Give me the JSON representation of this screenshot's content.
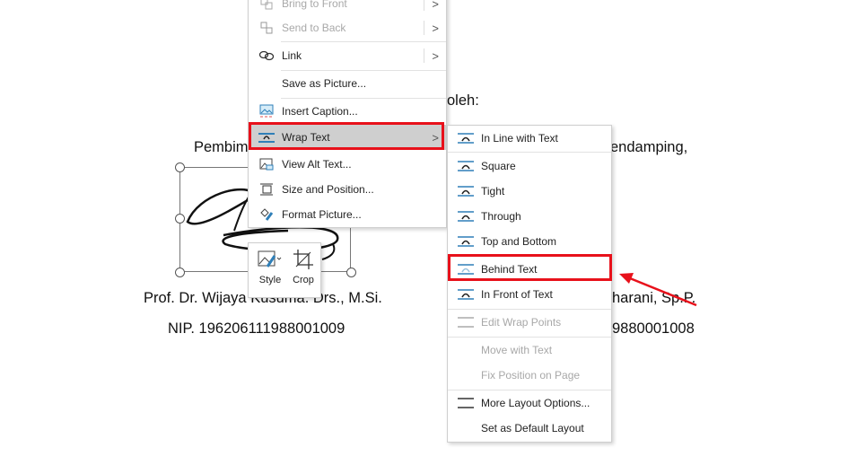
{
  "document": {
    "oleh": "oleh:",
    "left_heading": "Pembim",
    "right_heading": "endamping,",
    "left_name": "Prof. Dr. Wijaya Kusuma. Drs., M.Si.",
    "left_nip": "NIP. 196206111988001009",
    "right_name": "harani, Sp.P.",
    "right_nip": "9880001008"
  },
  "context_menu": {
    "items": [
      {
        "label": "Bring to Front",
        "icon": "bring-front-icon",
        "disabled": true,
        "submenu": true
      },
      {
        "label": "Send to Back",
        "icon": "send-back-icon",
        "disabled": true,
        "submenu": true
      },
      {
        "label": "Link",
        "icon": "link-icon",
        "submenu": true
      },
      {
        "label": "Save as Picture..."
      },
      {
        "label": "Insert Caption...",
        "icon": "caption-icon"
      },
      {
        "label": "Wrap Text",
        "icon": "wrap-text-icon",
        "submenu": true,
        "highlighted": true
      },
      {
        "label": "View Alt Text...",
        "icon": "alt-text-icon"
      },
      {
        "label": "Size and Position...",
        "icon": "size-position-icon"
      },
      {
        "label": "Format Picture...",
        "icon": "format-picture-icon"
      }
    ]
  },
  "mini_toolbar": {
    "style": "Style",
    "crop": "Crop"
  },
  "wrap_submenu": {
    "items": [
      {
        "label": "In Line with Text"
      },
      {
        "label": "Square"
      },
      {
        "label": "Tight"
      },
      {
        "label": "Through"
      },
      {
        "label": "Top and Bottom"
      },
      {
        "label": "Behind Text",
        "highlighted": true
      },
      {
        "label": "In Front of Text"
      },
      {
        "label": "Edit Wrap Points",
        "disabled": true
      },
      {
        "label": "Move with Text",
        "disabled": true
      },
      {
        "label": "Fix Position on Page",
        "disabled": true
      },
      {
        "label": "More Layout Options..."
      },
      {
        "label": "Set as Default Layout"
      }
    ]
  },
  "colors": {
    "highlight_box": "#e8111b",
    "menu_hover": "#cfcfcf",
    "icon_blue": "#2f7fb8"
  }
}
